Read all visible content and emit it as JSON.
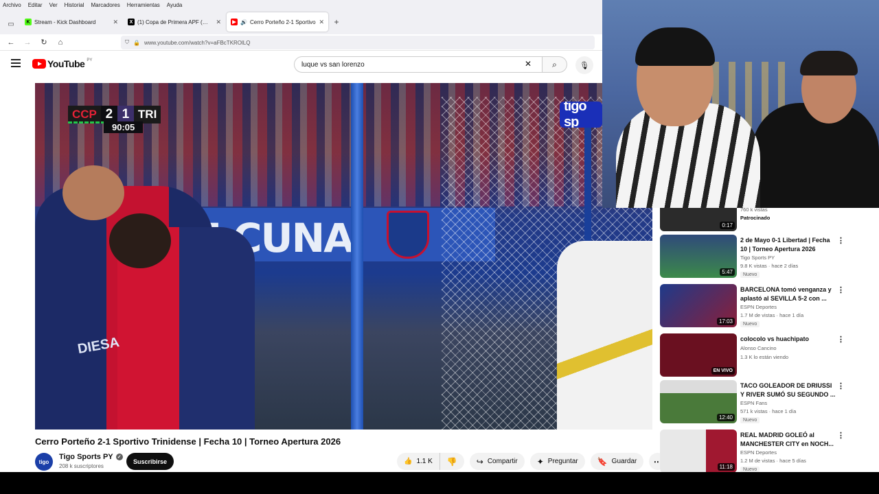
{
  "menubar": {
    "items": [
      "Archivo",
      "Editar",
      "Ver",
      "Historial",
      "Marcadores",
      "Herramientas",
      "Ayuda"
    ]
  },
  "tabs": [
    {
      "title": "Stream - Kick Dashboard",
      "icon": "kick-icon",
      "color": "#53fc18",
      "active": false
    },
    {
      "title": "(1) Copa de Primera APF (@Cop",
      "icon": "x-logo-icon",
      "color": "#000000",
      "active": false
    },
    {
      "title": "Cerro Porteño 2-1 Sportivo",
      "icon": "youtube-icon",
      "color": "#ff0000",
      "active": true
    }
  ],
  "address": {
    "url": "www.youtube.com/watch?v=aFBcTKROlLQ"
  },
  "youtube": {
    "logo_text": "YouTube",
    "region": "PY",
    "search_value": "luque vs san lorenzo"
  },
  "video": {
    "scoreboard": {
      "home": "CCP",
      "home_score": "2",
      "away_score": "1",
      "away": "TRI",
      "clock": "90:05"
    },
    "banner_text": "DE CUNA",
    "sponsor_text": "DIESA",
    "channel_bug": "tigo sp",
    "title": "Cerro Porteño 2-1 Sportivo Trinidense | Fecha 10 | Torneo Apertura 2026",
    "channel": {
      "avatar_text": "tigo",
      "name": "Tigo Sports PY",
      "subscribers": "208 k suscriptores",
      "subscribe_label": "Suscribirse"
    },
    "actions": {
      "likes": "1.1 K",
      "share": "Compartir",
      "ask": "Preguntar",
      "save": "Guardar"
    }
  },
  "recommendations": [
    {
      "title": "",
      "meta1": "760 k vistas",
      "meta2": "Patrocinado",
      "duration": "0:17",
      "thumb_color": "#2b2b2b"
    },
    {
      "title": "2 de Mayo 0-1 Libertad | Fecha 10 | Torneo Apertura 2026",
      "meta1": "Tigo Sports PY",
      "meta2": "9.8 K vistas · hace 2 días",
      "badge": "Nuevo",
      "duration": "5:47",
      "thumb_color": "#2e6b3c"
    },
    {
      "title": "BARCELONA tomó venganza y aplastó al SEVILLA 5-2 con ...",
      "meta1": "ESPN Deportes",
      "meta2": "1.7 M de vistas · hace 1 día",
      "badge": "Nuevo",
      "duration": "17:03",
      "thumb_color": "#7a1f3a"
    },
    {
      "title": "colocolo vs huachipato",
      "meta1": "Alonso Cancino",
      "meta2": "1.3 K lo están viendo",
      "live": "EN VIVO",
      "thumb_color": "#6a1020"
    },
    {
      "title": "TACO GOLEADOR DE DRIUSSI Y RIVER SUMÓ SU SEGUNDO ...",
      "meta1": "ESPN Fans",
      "meta2": "571 k vistas · hace 1 día",
      "badge": "Nuevo",
      "duration": "12:40",
      "thumb_color": "#4a7a3a"
    },
    {
      "title": "REAL MADRID GOLEÓ al MANCHESTER CITY en NOCH...",
      "meta1": "ESPN Deportes",
      "meta2": "1.2 M de vistas · hace 5 días",
      "badge": "Nuevo",
      "duration": "11:18",
      "thumb_color": "#a01830"
    }
  ]
}
